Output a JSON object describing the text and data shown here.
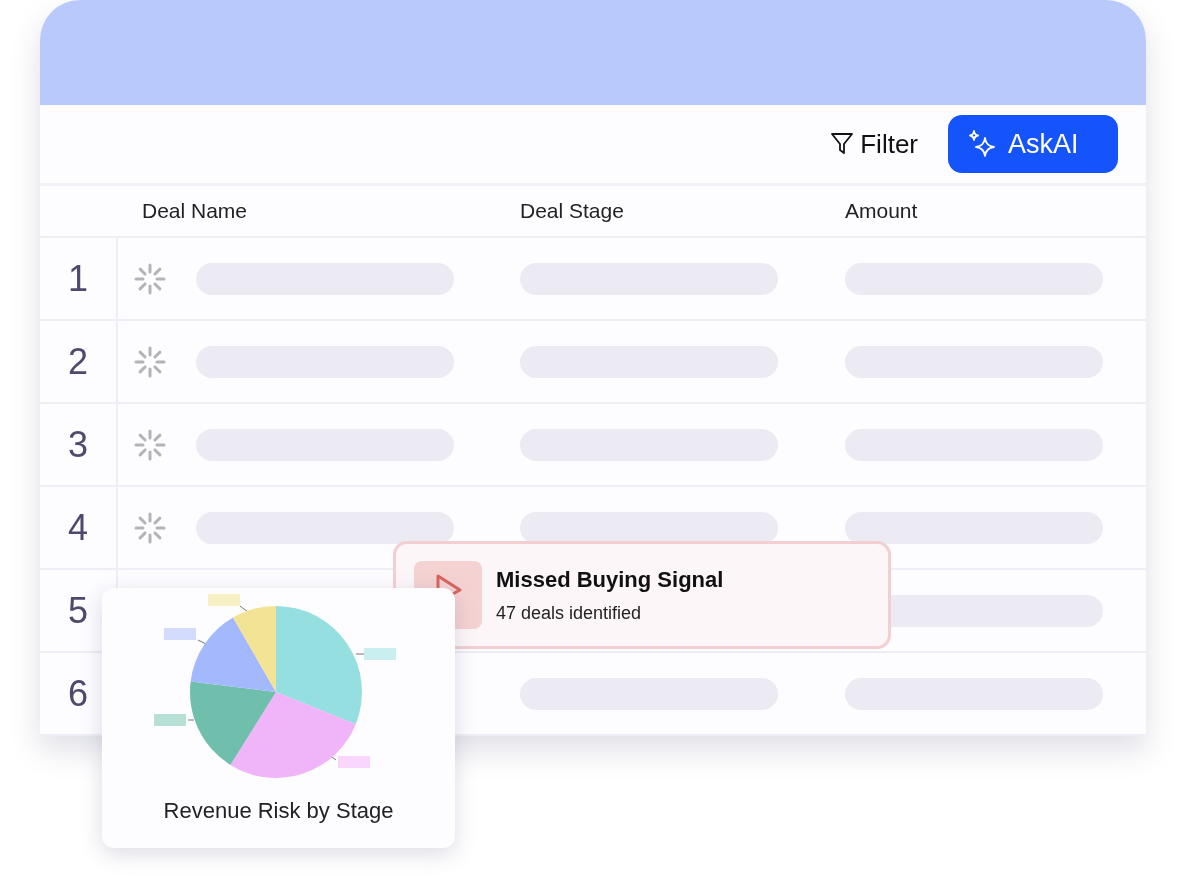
{
  "toolbar": {
    "filter_button": {
      "label": "Filter"
    },
    "ask_ai_button": {
      "label": "AskAI"
    }
  },
  "table": {
    "columns": [
      "Deal Name",
      "Deal Stage",
      "Amount"
    ],
    "rows": [
      {
        "number": "1"
      },
      {
        "number": "2"
      },
      {
        "number": "3"
      },
      {
        "number": "4"
      },
      {
        "number": "5"
      },
      {
        "number": "6"
      }
    ]
  },
  "alert_card": {
    "title": "Missed Buying Signal",
    "subtitle": "47 deals identified"
  },
  "chart_card": {
    "title": "Revenue Risk by Stage"
  }
}
